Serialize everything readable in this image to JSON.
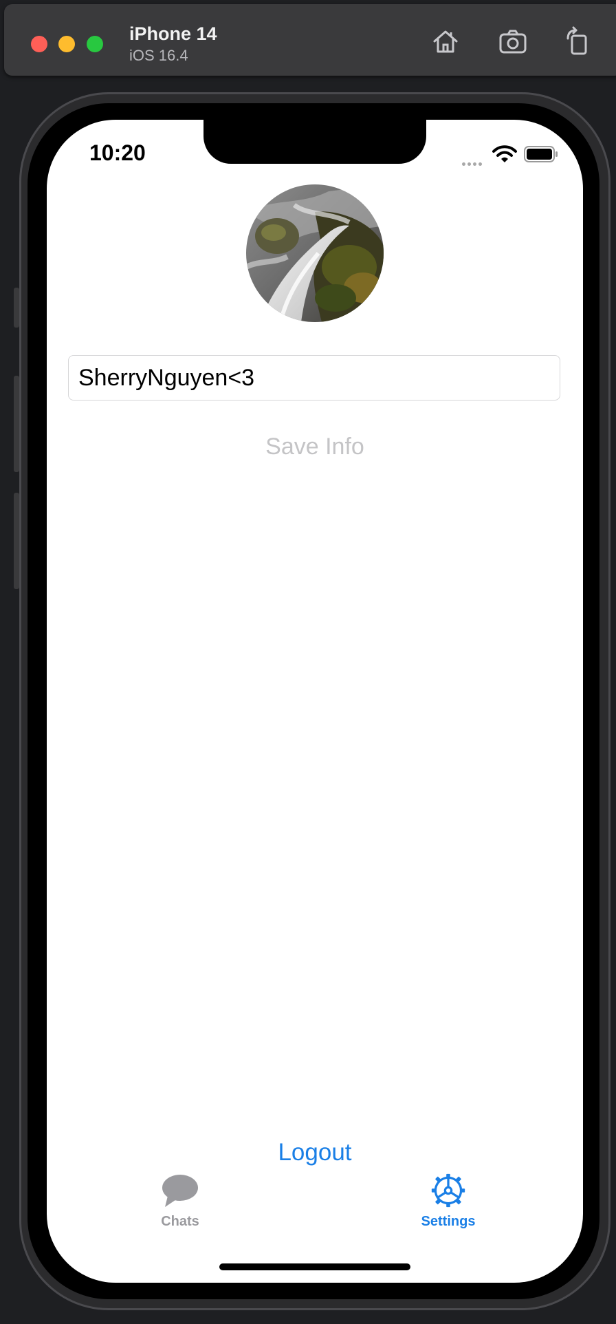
{
  "simulator": {
    "device_name": "iPhone 14",
    "os_version": "iOS 16.4",
    "toolbar_icons": [
      "home-icon",
      "screenshot-icon",
      "rotate-icon"
    ]
  },
  "status_bar": {
    "time": "10:20",
    "icons": [
      "cellular-dots-icon",
      "wifi-icon",
      "battery-icon"
    ]
  },
  "profile": {
    "avatar": "waterfall-photo",
    "name_value": "SherryNguyen<3",
    "name_placeholder": ""
  },
  "actions": {
    "save_label": "Save Info",
    "logout_label": "Logout"
  },
  "tab_bar": {
    "tabs": [
      {
        "label": "Chats",
        "icon": "chat-bubble-icon",
        "selected": false
      },
      {
        "label": "Settings",
        "icon": "gear-icon",
        "selected": true
      }
    ]
  },
  "colors": {
    "accent": "#1a7fe6",
    "disabled_text": "#c4c4c6",
    "inactive_tab": "#9a9a9e",
    "simulator_bar": "#3a3a3c",
    "background": "#1e1f22"
  }
}
